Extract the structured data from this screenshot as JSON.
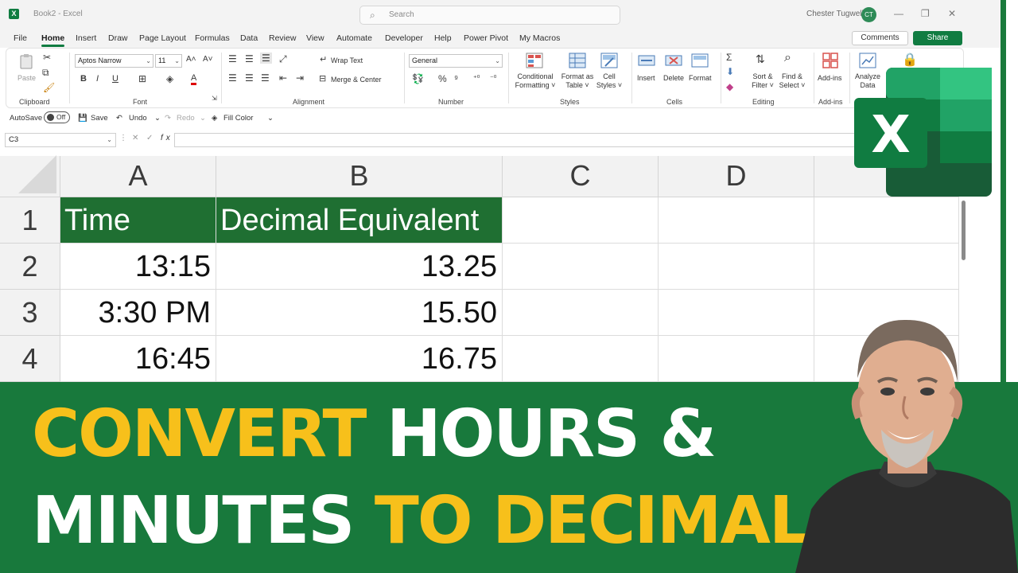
{
  "titlebar": {
    "app_icon": "X",
    "doc_title": "Book2  -  Excel",
    "search_placeholder": "Search",
    "user_name": "Chester Tugwell",
    "user_initials": "CT",
    "icons": [
      "search-icon",
      "minimize-icon",
      "maximize-icon",
      "close-icon"
    ]
  },
  "menu": {
    "tabs": [
      "File",
      "Home",
      "Insert",
      "Draw",
      "Page Layout",
      "Formulas",
      "Data",
      "Review",
      "View",
      "Automate",
      "Developer",
      "Help",
      "Power Pivot",
      "My Macros"
    ],
    "active_tab": "Home",
    "comments_label": "Comments",
    "share_label": "Share"
  },
  "ribbon": {
    "groups": [
      "Clipboard",
      "Font",
      "Alignment",
      "Number",
      "Styles",
      "Cells",
      "Editing",
      "Add-ins"
    ],
    "paste_label": "Paste",
    "font_name": "Aptos Narrow",
    "font_size": "11",
    "wrap_text": "Wrap Text",
    "merge_center": "Merge & Center",
    "number_format": "General",
    "conditional_formatting": [
      "Conditional",
      "Formatting ˅"
    ],
    "format_as_table": [
      "Format as",
      "Table ˅"
    ],
    "cell_styles": [
      "Cell",
      "Styles ˅"
    ],
    "insert": "Insert",
    "delete": "Delete",
    "format": "Format",
    "sort_filter": [
      "Sort &",
      "Filter ˅"
    ],
    "find_select": [
      "Find &",
      "Select ˅"
    ],
    "add_ins": "Add-ins",
    "analyze_data": [
      "Analyze",
      "Data"
    ]
  },
  "quick_access": {
    "autosave_label": "AutoSave",
    "autosave_state": "Off",
    "save": "Save",
    "undo": "Undo",
    "redo": "Redo",
    "fill_color": "Fill Color"
  },
  "formula_bar": {
    "name_box": "C3",
    "formula": ""
  },
  "sheet": {
    "columns": [
      "A",
      "B",
      "C",
      "D"
    ],
    "rows": [
      "1",
      "2",
      "3",
      "4"
    ],
    "header_row": [
      "Time",
      "Decimal Equivalent"
    ],
    "data": [
      [
        "13:15",
        "13.25"
      ],
      [
        "3:30 PM",
        "15.50"
      ],
      [
        "16:45",
        "16.75"
      ]
    ],
    "header_fill": "#1f6f32"
  },
  "banner": {
    "line1_highlight": "CONVERT",
    "line1_rest": " HOURS &",
    "line2_start": "MINUTES ",
    "line2_highlight": "TO DECIMAL",
    "highlight_color": "#f7c01b",
    "background": "#18793c"
  },
  "logo": {
    "letter": "X",
    "brand_color": "#107c41"
  }
}
